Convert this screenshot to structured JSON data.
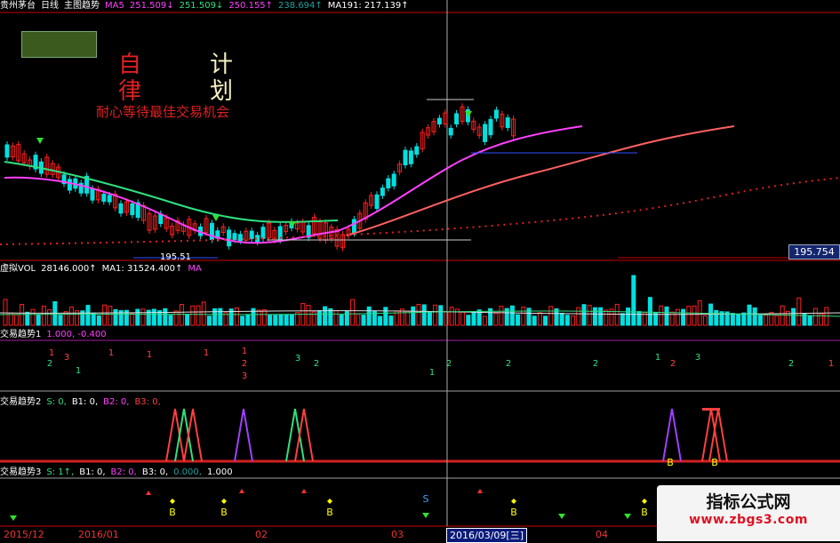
{
  "header_main": {
    "stock": "贵州茅台",
    "period": "日线",
    "indicator": "主图趋势",
    "ma5_label": "MA5",
    "ma_values": [
      "251.509↓",
      "251.509↓",
      "250.155↑",
      "238.694↑"
    ],
    "ma191": "MA191: 217.139↑"
  },
  "annotation": {
    "char1": "自",
    "char2": "律",
    "char3": "计",
    "char4": "划",
    "slogan": "耐心等待最佳交易机会"
  },
  "price_labels": {
    "low_marker": "195.51",
    "current_price": "195.754"
  },
  "volume_header": {
    "name": "虚拟VOL",
    "value": "28146.000↑",
    "ma1": "MA1: 31524.400↑",
    "ma": "MA"
  },
  "trend1_header": {
    "name": "交易趋势1",
    "values": "1.000, -0.400"
  },
  "trend2_header": {
    "name": "交易趋势2",
    "s": "S: 0,",
    "b1": "B1: 0,",
    "b2": "B2: 0,",
    "b3": "B3: 0,"
  },
  "trend3_header": {
    "name": "交易趋势3",
    "s": "S: 1↑,",
    "b1": "B1: 0,",
    "b2": "B2: 0,",
    "b3": "B3: 0,",
    "v1": "0.000,",
    "v2": "1.000"
  },
  "x_axis": {
    "labels": [
      "2015/12",
      "2016/01",
      "02",
      "03",
      "04"
    ],
    "selected": "2016/03/09[三]"
  },
  "markers": {
    "buy": "B",
    "sell": "S"
  },
  "watermark": {
    "line1": "指标公式网",
    "line2": "www.zbgs3.com"
  },
  "colors": {
    "up": "#ff2020",
    "down": "#00e0e0",
    "ma_green": "#30e080",
    "ma_magenta": "#ff40ff",
    "ma_salmon": "#ff6060",
    "bg": "#000000"
  }
}
